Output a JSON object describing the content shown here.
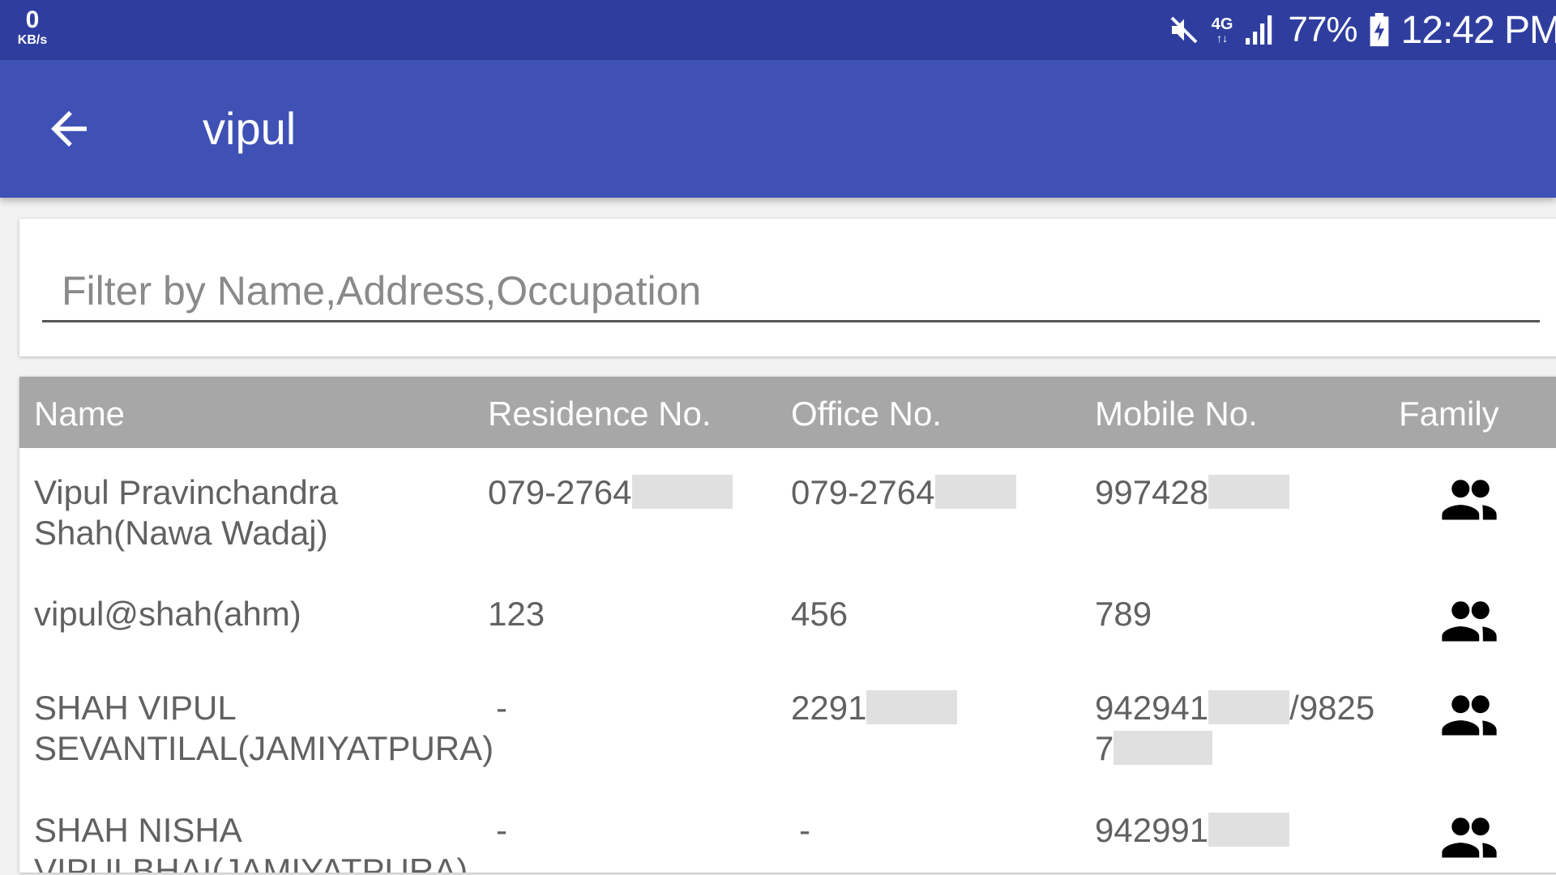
{
  "status_bar": {
    "net_speed_value": "0",
    "net_speed_unit": "KB/s",
    "network_type": "4G",
    "network_arrows": "↑↓",
    "battery_percent": "77%",
    "time": "12:42 PM"
  },
  "app_bar": {
    "title": "vipul"
  },
  "filter": {
    "placeholder": "Filter by Name,Address,Occupation",
    "value": ""
  },
  "table": {
    "columns": [
      "Name",
      "Residence No.",
      "Office No.",
      "Mobile No.",
      "Family"
    ],
    "rows": [
      {
        "name": "Vipul Pravinchandra Shah(Nawa Wadaj)",
        "residence": "079-2764",
        "office": "079-2764",
        "mobile": "997428",
        "mobile2": ""
      },
      {
        "name": "vipul@shah(ahm)",
        "residence": "123",
        "office": "456",
        "mobile": "789",
        "mobile2": ""
      },
      {
        "name": "SHAH VIPUL SEVANTILAL(JAMIYATPURA)",
        "residence": "-",
        "office": "2291",
        "mobile": "942941",
        "mobile_sep": "/9825",
        "mobile2": "7"
      },
      {
        "name": "SHAH NISHA VIPULBHAI(JAMIYATPURA)",
        "residence": "-",
        "office": "-",
        "mobile": "942991",
        "mobile2": ""
      }
    ]
  },
  "icons": {
    "back": "arrow-back-icon",
    "family": "people-icon",
    "mute": "volume-mute-icon",
    "signal": "signal-icon",
    "battery": "battery-charging-icon"
  },
  "colors": {
    "status_bar": "#2f3e9e",
    "app_bar": "#3f51b5",
    "table_header": "#a7a7a7",
    "text": "#616161"
  }
}
